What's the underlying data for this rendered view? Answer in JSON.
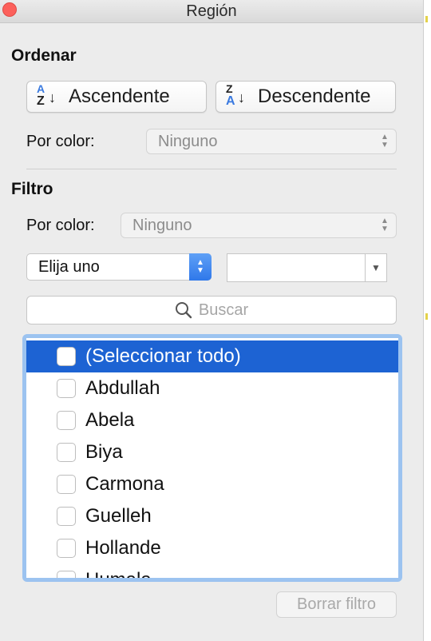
{
  "window": {
    "title": "Región"
  },
  "sort": {
    "heading": "Ordenar",
    "ascending_label": "Ascendente",
    "descending_label": "Descendente",
    "asc_icon_top": "A",
    "asc_icon_bottom": "Z",
    "desc_icon_top": "Z",
    "desc_icon_bottom": "A",
    "by_color_label": "Por color:",
    "by_color_value": "Ninguno"
  },
  "filter": {
    "heading": "Filtro",
    "by_color_label": "Por color:",
    "by_color_value": "Ninguno",
    "condition_value": "Elija uno",
    "condition_input_value": "",
    "search_placeholder": "Buscar",
    "items": [
      {
        "label": "(Seleccionar todo)",
        "checked": false,
        "selected": true
      },
      {
        "label": "Abdullah",
        "checked": false,
        "selected": false
      },
      {
        "label": "Abela",
        "checked": false,
        "selected": false
      },
      {
        "label": "Biya",
        "checked": false,
        "selected": false
      },
      {
        "label": "Carmona",
        "checked": false,
        "selected": false
      },
      {
        "label": "Guelleh",
        "checked": false,
        "selected": false
      },
      {
        "label": "Hollande",
        "checked": false,
        "selected": false
      },
      {
        "label": "Humala",
        "checked": false,
        "selected": false
      }
    ],
    "clear_label": "Borrar filtro"
  },
  "colors": {
    "accent": "#1d63d3",
    "close": "#fc605b",
    "list_border": "#9cc3f0"
  },
  "icons": {
    "close": "close-icon",
    "updown": "updown-chevron-icon",
    "search": "search-icon",
    "dropdown": "chevron-down-icon"
  }
}
